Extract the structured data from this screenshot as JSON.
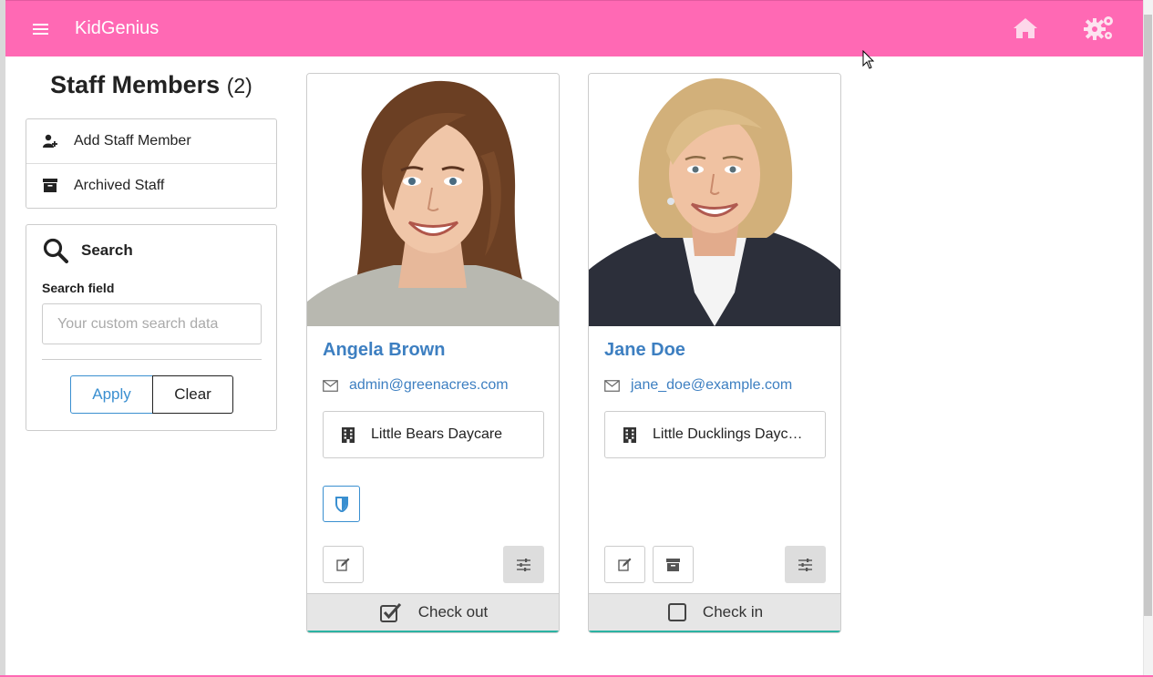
{
  "app": {
    "brand": "KidGenius",
    "accent_color": "#ff69b4",
    "link_color": "#3d7fc1",
    "icons": {
      "menu": "hamburger-icon",
      "home": "home-icon",
      "settings": "gears-icon"
    }
  },
  "sidebar": {
    "title": "Staff Members",
    "count": "(2)",
    "menu": [
      {
        "label": "Add Staff Member",
        "icon": "add-user-icon"
      },
      {
        "label": "Archived Staff",
        "icon": "archive-icon"
      }
    ],
    "search": {
      "title": "Search",
      "field_label": "Search field",
      "placeholder": "Your custom search data",
      "value": "",
      "apply_label": "Apply",
      "clear_label": "Clear"
    }
  },
  "staff": [
    {
      "name": "Angela Brown",
      "email": "admin@greenacres.com",
      "location": "Little Bears Daycare",
      "has_role_badge": true,
      "check_label": "Check out",
      "checked": true
    },
    {
      "name": "Jane Doe",
      "email": "jane_doe@example.com",
      "location": "Little Ducklings Daycare",
      "has_role_badge": false,
      "check_label": "Check in",
      "checked": false
    }
  ]
}
